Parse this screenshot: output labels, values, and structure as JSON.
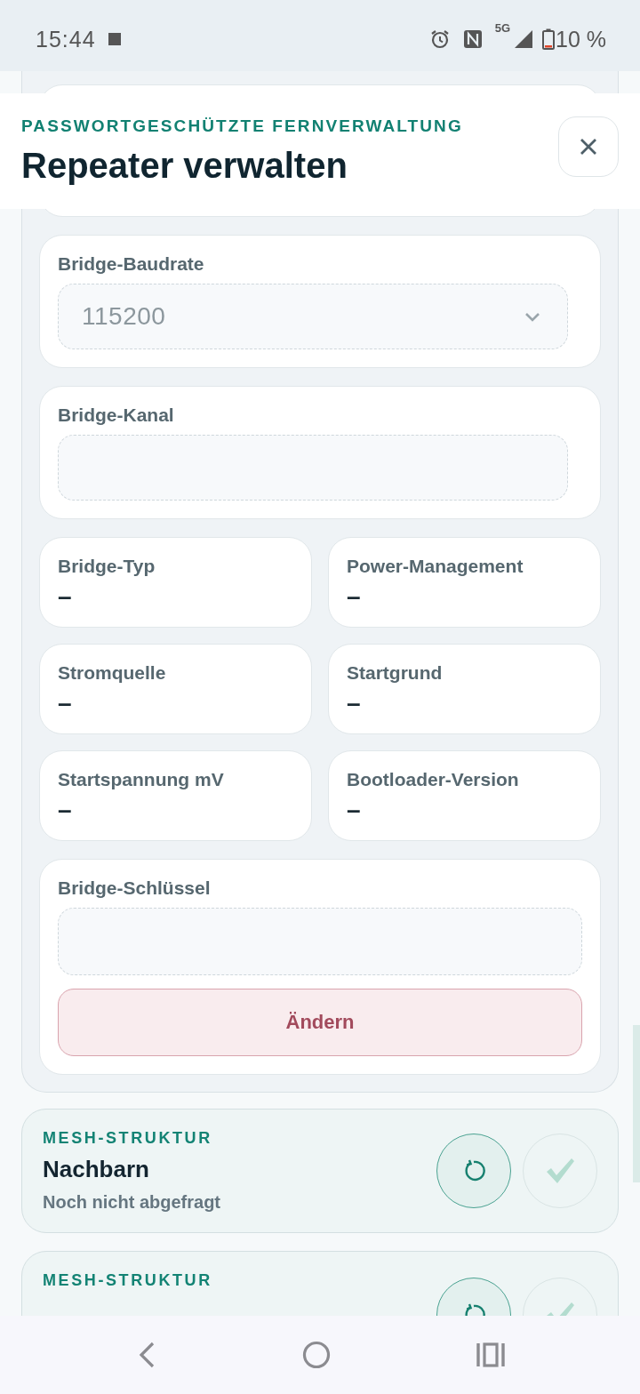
{
  "status_bar": {
    "time": "15:44",
    "network": "5G",
    "battery": "10 %"
  },
  "header": {
    "kicker": "PASSWORTGESCHÜTZTE FERNVERWALTUNG",
    "title": "Repeater verwalten"
  },
  "settings": [
    {
      "kind": "select",
      "label": "Bridge-Baudrate",
      "value": "115200",
      "disabled": true
    },
    {
      "kind": "input",
      "label": "Bridge-Kanal",
      "disabled": true
    }
  ],
  "info_tiles": [
    {
      "label": "Bridge-Typ",
      "value": "–"
    },
    {
      "label": "Power-Management",
      "value": "–"
    },
    {
      "label": "Stromquelle",
      "value": "–"
    },
    {
      "label": "Startgrund",
      "value": "–"
    },
    {
      "label": "Startspannung mV",
      "value": "–"
    },
    {
      "label": "Bootloader-Version",
      "value": "–"
    }
  ],
  "key_setting": {
    "label": "Bridge-Schlüssel",
    "disabled": true,
    "button": "Ändern"
  },
  "mesh_cards": [
    {
      "kicker": "MESH-STRUKTUR",
      "title": "Nachbarn",
      "status": "Noch nicht abgefragt",
      "confirm_disabled": true
    },
    {
      "kicker": "MESH-STRUKTUR",
      "confirm_disabled": true
    }
  ]
}
